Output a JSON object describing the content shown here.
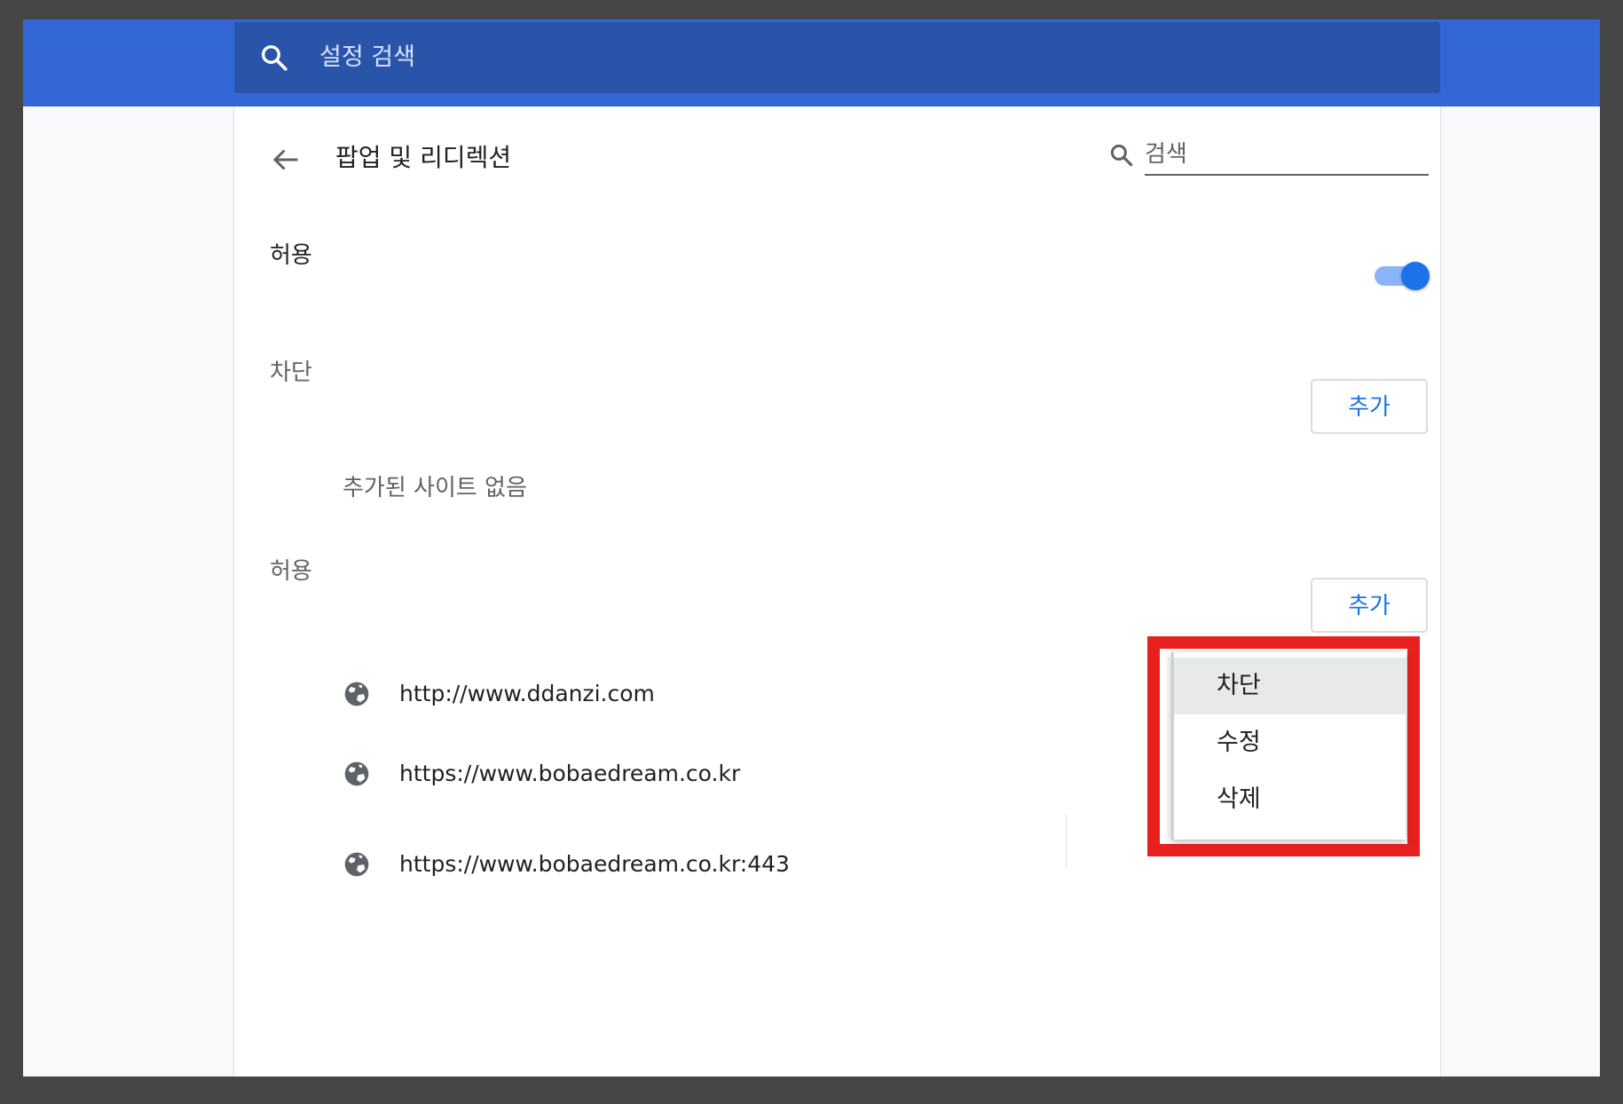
{
  "header": {
    "search_placeholder": "설정 검색"
  },
  "page": {
    "title": "팝업 및 리디렉션",
    "search_placeholder": "검색"
  },
  "main_toggle": {
    "label": "허용",
    "enabled": true
  },
  "block_section": {
    "label": "차단",
    "add_label": "추가",
    "empty_text": "추가된 사이트 없음"
  },
  "allow_section": {
    "label": "허용",
    "add_label": "추가",
    "sites": [
      {
        "url": "http://www.ddanzi.com"
      },
      {
        "url": "https://www.bobaedream.co.kr"
      },
      {
        "url": "https://www.bobaedream.co.kr:443"
      }
    ]
  },
  "context_menu": {
    "items": [
      {
        "label": "차단"
      },
      {
        "label": "수정"
      },
      {
        "label": "삭제"
      }
    ]
  },
  "colors": {
    "accent": "#1a73e8",
    "header_bg": "#3367d6",
    "highlight": "#e8211f"
  }
}
